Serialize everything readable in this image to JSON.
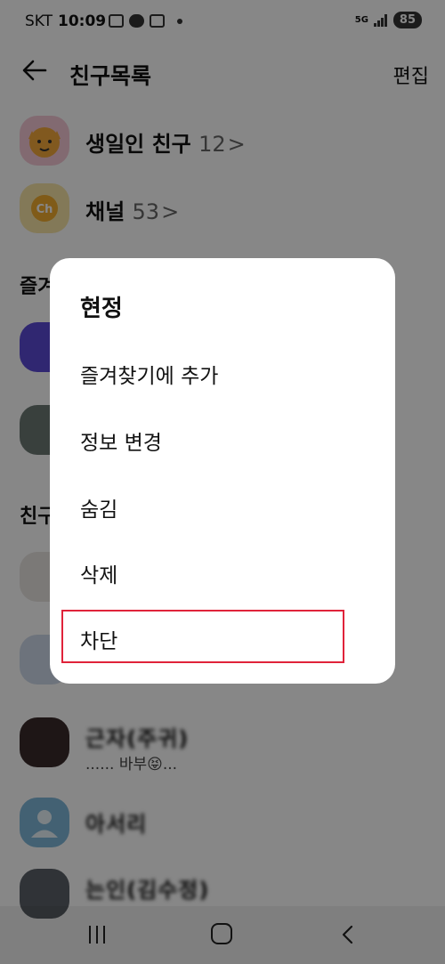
{
  "status_bar": {
    "carrier": "SKT",
    "time": "10:09",
    "network": "5G",
    "battery": "85"
  },
  "header": {
    "title": "친구목록",
    "edit_label": "편집"
  },
  "rows": {
    "birthday": {
      "name": "생일인 친구",
      "count": "12",
      "chevron": ">"
    },
    "channel": {
      "name": "채널",
      "count": "53",
      "chevron": ">"
    }
  },
  "sections": {
    "favorites": "즐겨",
    "friends": "친구"
  },
  "friends": [
    {
      "name": "",
      "message": ""
    },
    {
      "name": "",
      "message": ""
    },
    {
      "name": "근자(주귀)",
      "message": "...... 바부😝..."
    },
    {
      "name": "아서리",
      "message": ""
    },
    {
      "name": "는인(김수정)",
      "message": ""
    }
  ],
  "menu": {
    "title": "현정",
    "items": [
      "즐겨찾기에 추가",
      "정보 변경",
      "숨김",
      "삭제",
      "차단"
    ]
  },
  "colors": {
    "highlight": "#e0233a",
    "overlay": "rgba(0,0,0,0.47)"
  }
}
